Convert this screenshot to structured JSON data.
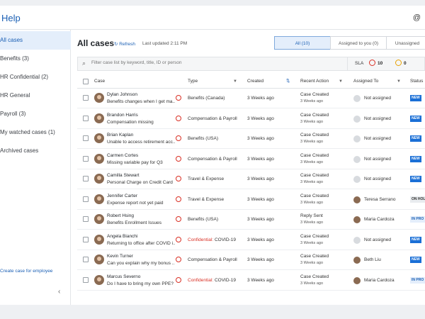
{
  "app": {
    "title": "Help",
    "top_right_icon": "@"
  },
  "sidebar": {
    "items": [
      {
        "label": "All cases",
        "active": true
      },
      {
        "label": "Benefits (3)"
      },
      {
        "label": "HR Confidential (2)"
      },
      {
        "label": "HR General"
      },
      {
        "label": "Payroll (3)"
      },
      {
        "label": "My watched cases (1)"
      },
      {
        "label": "Archived cases"
      }
    ],
    "create_link": "Create case for employee",
    "collapse_icon": "‹"
  },
  "main": {
    "title": "All cases",
    "refresh_label": "Refresh",
    "last_updated": "Last updated 2:11 PM",
    "tabs": [
      {
        "label": "All (10)",
        "active": true
      },
      {
        "label": "Assigned to you (0)"
      },
      {
        "label": "Unassigned"
      }
    ],
    "search": {
      "placeholder": "Filter case list by keyword, title, ID or person"
    },
    "sla": {
      "label": "SLA",
      "red_count": "10",
      "orange_count": "0"
    },
    "columns": {
      "case": "Case",
      "type": "Type",
      "created": "Created",
      "recent_action": "Recent Action",
      "assigned_to": "Assigned To",
      "status": "Status"
    }
  },
  "rows": [
    {
      "name": "Dylan Johnson",
      "subject": "Benefits changes when I get ma...",
      "type": "Benefits (Canada)",
      "confidential": "",
      "created": "3 Weeks ago",
      "action": "Case Created",
      "action_sub": "3 Weeks ago",
      "assignee": "Not assigned",
      "assignee_photo": false,
      "status": "NEW",
      "status_kind": "new"
    },
    {
      "name": "Brandon Harris",
      "subject": "Compensation missing",
      "type": "Compensation & Payroll",
      "confidential": "",
      "created": "3 Weeks ago",
      "action": "Case Created",
      "action_sub": "3 Weeks ago",
      "assignee": "Not assigned",
      "assignee_photo": false,
      "status": "NEW",
      "status_kind": "new"
    },
    {
      "name": "Brian Kaplan",
      "subject": "Unable to access retirement acc...",
      "type": "Benefits (USA)",
      "confidential": "",
      "created": "3 Weeks ago",
      "action": "Case Created",
      "action_sub": "3 Weeks ago",
      "assignee": "Not assigned",
      "assignee_photo": false,
      "status": "NEW",
      "status_kind": "new"
    },
    {
      "name": "Carmen Cortes",
      "subject": "Missing variable pay for Q3",
      "type": "Compensation & Payroll",
      "confidential": "",
      "created": "3 Weeks ago",
      "action": "Case Created",
      "action_sub": "3 Weeks ago",
      "assignee": "Not assigned",
      "assignee_photo": false,
      "status": "NEW",
      "status_kind": "new"
    },
    {
      "name": "Camilla Stewart",
      "subject": "Personal Charge on Credit Card",
      "type": "Travel & Expense",
      "confidential": "",
      "created": "3 Weeks ago",
      "action": "Case Created",
      "action_sub": "3 Weeks ago",
      "assignee": "Not assigned",
      "assignee_photo": false,
      "status": "NEW",
      "status_kind": "new"
    },
    {
      "name": "Jennifer Carter",
      "subject": "Expense report not yet paid",
      "type": "Travel & Expense",
      "confidential": "",
      "created": "3 Weeks ago",
      "action": "Case Created",
      "action_sub": "3 Weeks ago",
      "assignee": "Teresa Serrano",
      "assignee_photo": true,
      "status": "ON HOL",
      "status_kind": "hold"
    },
    {
      "name": "Robert Hsing",
      "subject": "Benefits Enrollment Issues",
      "type": "Benefits (USA)",
      "confidential": "",
      "created": "3 Weeks ago",
      "action": "Reply Sent",
      "action_sub": "3 Weeks ago",
      "assignee": "Maria Cardoza",
      "assignee_photo": true,
      "status": "IN PRO",
      "status_kind": "prog"
    },
    {
      "name": "Angela Bianchi",
      "subject": "Returning to office after COVID i...",
      "type": "COVID-19",
      "confidential": "Confidential:",
      "created": "3 Weeks ago",
      "action": "Case Created",
      "action_sub": "3 Weeks ago",
      "assignee": "Not assigned",
      "assignee_photo": false,
      "status": "NEW",
      "status_kind": "new"
    },
    {
      "name": "Kevin Turner",
      "subject": "Can you explain why my bonus ...",
      "type": "Compensation & Payroll",
      "confidential": "",
      "created": "3 Weeks ago",
      "action": "Case Created",
      "action_sub": "3 Weeks ago",
      "assignee": "Beth Liu",
      "assignee_photo": true,
      "status": "NEW",
      "status_kind": "new"
    },
    {
      "name": "Marcus Severno",
      "subject": "Do I have to bring my own PPE?",
      "type": "COVID-19",
      "confidential": "Confidential:",
      "created": "3 Weeks ago",
      "action": "Case Created",
      "action_sub": "3 Weeks ago",
      "assignee": "Maria Cardoza",
      "assignee_photo": true,
      "status": "IN PRO",
      "status_kind": "prog"
    }
  ]
}
